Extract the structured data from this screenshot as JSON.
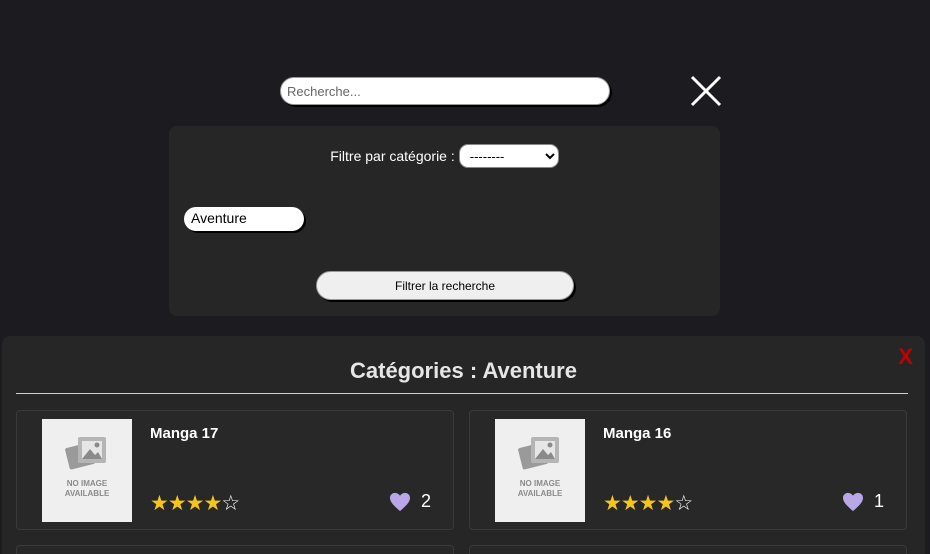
{
  "search": {
    "placeholder": "Recherche..."
  },
  "filter": {
    "label": "Filtre par catégorie :",
    "select_value": "--------",
    "chip_label": "Aventure",
    "submit_label": "Filtrer la recherche"
  },
  "results": {
    "close_label": "X",
    "title": "Catégories : Aventure",
    "cards": [
      {
        "title": "Manga 17",
        "thumb_text": "NO IMAGE AVAILABLE",
        "rating": 4,
        "max_rating": 5,
        "likes": "2"
      },
      {
        "title": "Manga 16",
        "thumb_text": "NO IMAGE AVAILABLE",
        "rating": 4,
        "max_rating": 5,
        "likes": "1"
      }
    ]
  },
  "colors": {
    "background": "#1c1b20",
    "panel": "#262626",
    "star": "#f5c518",
    "heart": "#b9a7e8",
    "close": "#c00000"
  }
}
